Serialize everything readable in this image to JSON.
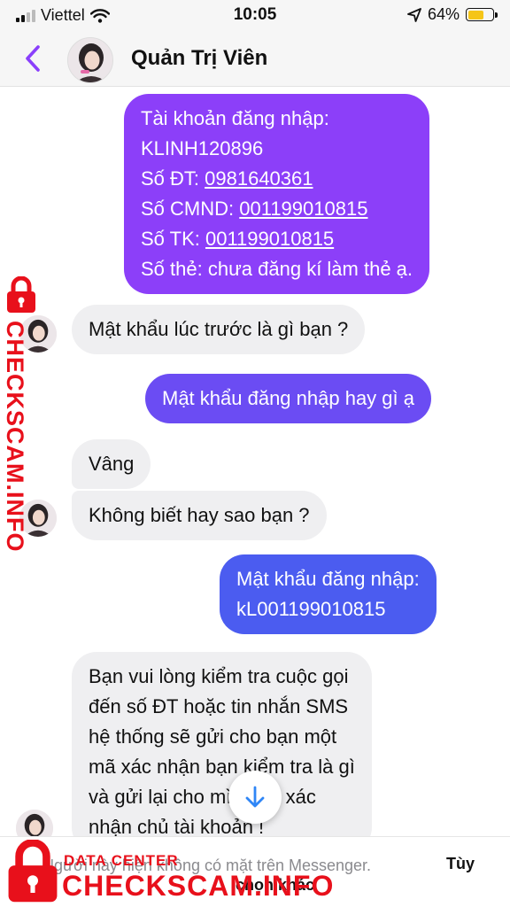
{
  "status_bar": {
    "carrier": "Viettel",
    "time": "10:05",
    "battery_percent": "64%",
    "battery_level": 0.64,
    "icons": [
      "signal-icon",
      "wifi-icon",
      "location-icon",
      "battery-icon"
    ]
  },
  "header": {
    "contact_name": "Quản Trị Viên",
    "back_icon": "chevron-left-icon",
    "accent_color": "#8a3ffc"
  },
  "messages": [
    {
      "from": "me",
      "lines": [
        {
          "parts": [
            {
              "t": "Tài khoản đăng nhập:"
            }
          ]
        },
        {
          "parts": [
            {
              "t": "KLINH120896"
            }
          ]
        },
        {
          "parts": [
            {
              "t": "Số ĐT: "
            },
            {
              "t": "0981640361",
              "u": true
            }
          ]
        },
        {
          "parts": [
            {
              "t": "Số CMND: "
            },
            {
              "t": "001199010815",
              "u": true
            }
          ]
        },
        {
          "parts": [
            {
              "t": "Số TK: "
            },
            {
              "t": "001199010815",
              "u": true
            }
          ]
        },
        {
          "parts": [
            {
              "t": "Số thẻ: chưa đăng kí làm thẻ ạ."
            }
          ]
        }
      ]
    },
    {
      "from": "them",
      "lines": [
        {
          "parts": [
            {
              "t": "Mật khẩu lúc trước là gì bạn ?"
            }
          ]
        }
      ]
    },
    {
      "from": "me",
      "lines": [
        {
          "parts": [
            {
              "t": "Mật khẩu đăng nhập hay gì ạ"
            }
          ]
        }
      ]
    },
    {
      "from": "them",
      "lines": [
        {
          "parts": [
            {
              "t": "Vâng"
            }
          ]
        }
      ]
    },
    {
      "from": "them",
      "lines": [
        {
          "parts": [
            {
              "t": "Không biết hay sao bạn ?"
            }
          ]
        }
      ]
    },
    {
      "from": "me",
      "lines": [
        {
          "parts": [
            {
              "t": "Mật khẩu đăng nhập:"
            }
          ]
        },
        {
          "parts": [
            {
              "t": "kL001199010815"
            }
          ]
        }
      ]
    },
    {
      "from": "them",
      "lines": [
        {
          "parts": [
            {
              "t": "Bạn vui lòng kiểm tra cuộc gọi"
            }
          ]
        },
        {
          "parts": [
            {
              "t": "đến số ĐT hoặc tin nhắn SMS"
            }
          ]
        },
        {
          "parts": [
            {
              "t": "hệ thống sẽ gửi cho bạn một"
            }
          ]
        },
        {
          "parts": [
            {
              "t": "mã xác nhận bạn kiểm tra là gì"
            }
          ]
        },
        {
          "parts": [
            {
              "t": "và gửi lại cho mình để xác"
            }
          ]
        },
        {
          "parts": [
            {
              "t": "nhận chủ tài khoản !"
            }
          ]
        }
      ]
    }
  ],
  "scroll_button_icon": "arrow-down-icon",
  "bottom": {
    "notice": "Người này hiện không có mặt trên Messenger.",
    "link_line1": "Tùy",
    "link_line2": "chọn khác"
  },
  "watermark": {
    "brand": "CHECKSCAM.INFO",
    "sub": "DATA CENTER",
    "icon": "lock-icon",
    "color": "#e8101b"
  }
}
